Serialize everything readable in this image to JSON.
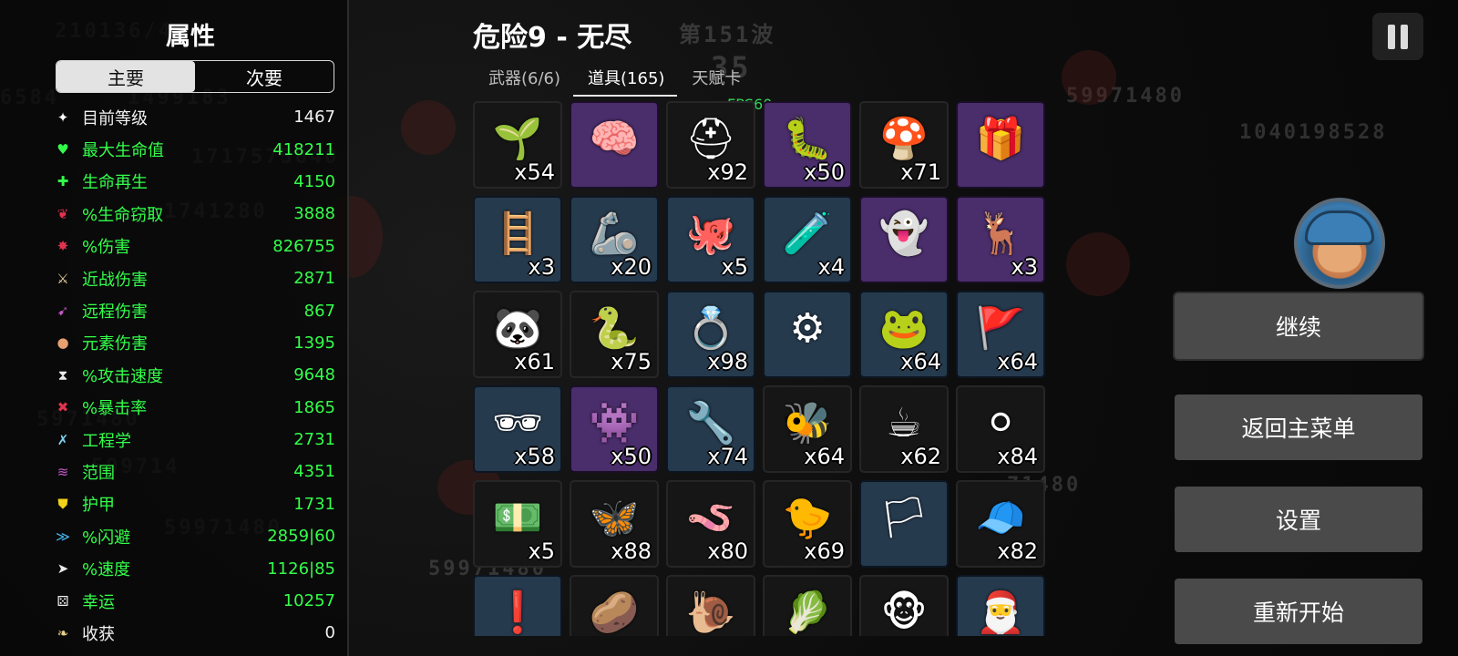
{
  "stats_panel": {
    "title": "属性",
    "tabs": {
      "primary": "主要",
      "secondary": "次要"
    },
    "stats": [
      {
        "icon": "level-icon",
        "glyph": "✦",
        "label": "目前等级",
        "value": "1467",
        "style": "normal",
        "icon_color": "#ffffff"
      },
      {
        "icon": "heart-icon",
        "glyph": "♥",
        "label": "最大生命值",
        "value": "418211",
        "style": "green",
        "icon_color": "#33ff4a"
      },
      {
        "icon": "regen-icon",
        "glyph": "✚",
        "label": "生命再生",
        "value": "4150",
        "style": "green",
        "icon_color": "#33ff4a"
      },
      {
        "icon": "lifesteal-icon",
        "glyph": "❦",
        "label": "%生命窃取",
        "value": "3888",
        "style": "green",
        "icon_color": "#e0334f"
      },
      {
        "icon": "damage-icon",
        "glyph": "✸",
        "label": "%伤害",
        "value": "826755",
        "style": "green",
        "icon_color": "#e0334f"
      },
      {
        "icon": "melee-icon",
        "glyph": "⚔",
        "label": "近战伤害",
        "value": "2871",
        "style": "green",
        "icon_color": "#f0d8a0"
      },
      {
        "icon": "ranged-icon",
        "glyph": "➹",
        "label": "远程伤害",
        "value": "867",
        "style": "green",
        "icon_color": "#c058c8"
      },
      {
        "icon": "elemental-icon",
        "glyph": "●",
        "label": "元素伤害",
        "value": "1395",
        "style": "green",
        "icon_color": "#e8a070"
      },
      {
        "icon": "attack-speed-icon",
        "glyph": "⧗",
        "label": "%攻击速度",
        "value": "9648",
        "style": "green",
        "icon_color": "#eaeaea"
      },
      {
        "icon": "crit-icon",
        "glyph": "✖",
        "label": "%暴击率",
        "value": "1865",
        "style": "green",
        "icon_color": "#e0334f"
      },
      {
        "icon": "engineering-icon",
        "glyph": "✗",
        "label": "工程学",
        "value": "2731",
        "style": "green",
        "icon_color": "#7fd0f0"
      },
      {
        "icon": "range-icon",
        "glyph": "≋",
        "label": "范围",
        "value": "4351",
        "style": "green",
        "icon_color": "#c058c8"
      },
      {
        "icon": "armor-icon",
        "glyph": "⛊",
        "label": "护甲",
        "value": "1731",
        "style": "green",
        "icon_color": "#f2d21a"
      },
      {
        "icon": "dodge-icon",
        "glyph": "≫",
        "label": "%闪避",
        "value": "2859|60",
        "style": "green",
        "icon_color": "#4ab8f0"
      },
      {
        "icon": "speed-icon",
        "glyph": "➤",
        "label": "%速度",
        "value": "1126|85",
        "style": "green",
        "icon_color": "#eaeaea"
      },
      {
        "icon": "luck-icon",
        "glyph": "⚄",
        "label": "幸运",
        "value": "10257",
        "style": "green",
        "icon_color": "#eaeaea"
      },
      {
        "icon": "harvest-icon",
        "glyph": "❧",
        "label": "收获",
        "value": "0",
        "style": "normal",
        "icon_color": "#e8d08a"
      }
    ]
  },
  "header": {
    "title": "危险9 - 无尽",
    "tabs": [
      {
        "label": "武器(6/6)",
        "active": false
      },
      {
        "label": "道具(165)",
        "active": true
      },
      {
        "label": "天赋卡",
        "active": false
      }
    ],
    "fps": "FPS60"
  },
  "background": {
    "floating_numbers": [
      "210136/4",
      "6584",
      "1499183",
      "1717575040",
      "1741280",
      "59971480",
      "1040198528",
      "5971480",
      "599714",
      "59971480",
      "59971480",
      "71480",
      "第151波",
      "35"
    ]
  },
  "items": [
    {
      "name": "sprout-item-icon",
      "glyph": "🌱",
      "count": "x54",
      "tier": "dark"
    },
    {
      "name": "brain-item-icon",
      "glyph": "🧠",
      "count": "",
      "tier": "purple"
    },
    {
      "name": "helmet-item-icon",
      "glyph": "⛑",
      "count": "x92",
      "tier": "dark"
    },
    {
      "name": "tardigrade-item-icon",
      "glyph": "🐛",
      "count": "x50",
      "tier": "purple"
    },
    {
      "name": "mushroom-item-icon",
      "glyph": "🍄",
      "count": "x71",
      "tier": "dark"
    },
    {
      "name": "gift-box-item-icon",
      "glyph": "🎁",
      "count": "",
      "tier": "purple"
    },
    {
      "name": "slime-ladder-item-icon",
      "glyph": "🪜",
      "count": "x3",
      "tier": "blue"
    },
    {
      "name": "robot-arm-item-icon",
      "glyph": "🦾",
      "count": "x20",
      "tier": "blue"
    },
    {
      "name": "tentacle-item-icon",
      "glyph": "🐙",
      "count": "x5",
      "tier": "blue"
    },
    {
      "name": "potion-bottle-item-icon",
      "glyph": "🧪",
      "count": "x4",
      "tier": "blue"
    },
    {
      "name": "white-ghost-item-icon",
      "glyph": "👻",
      "count": "",
      "tier": "purple"
    },
    {
      "name": "antlered-beast-item-icon",
      "glyph": "🦌",
      "count": "x3",
      "tier": "purple"
    },
    {
      "name": "panda-mask-item-icon",
      "glyph": "🐼",
      "count": "x61",
      "tier": "dark"
    },
    {
      "name": "green-snake-item-icon",
      "glyph": "🐍",
      "count": "x75",
      "tier": "dark"
    },
    {
      "name": "ring-item-icon",
      "glyph": "💍",
      "count": "x98",
      "tier": "blue"
    },
    {
      "name": "turret-item-icon",
      "glyph": "⚙",
      "count": "",
      "tier": "blue"
    },
    {
      "name": "frog-item-icon",
      "glyph": "🐸",
      "count": "x64",
      "tier": "blue"
    },
    {
      "name": "red-flag-item-icon",
      "glyph": "🚩",
      "count": "x64",
      "tier": "blue"
    },
    {
      "name": "goggles-item-icon",
      "glyph": "🕶",
      "count": "x58",
      "tier": "blue"
    },
    {
      "name": "monster-ring-item-icon",
      "glyph": "👾",
      "count": "x50",
      "tier": "purple"
    },
    {
      "name": "hook-item-icon",
      "glyph": "🔧",
      "count": "x74",
      "tier": "blue"
    },
    {
      "name": "bee-item-icon",
      "glyph": "🐝",
      "count": "x64",
      "tier": "dark"
    },
    {
      "name": "cup-item-icon",
      "glyph": "☕",
      "count": "x62",
      "tier": "dark"
    },
    {
      "name": "snowball-item-icon",
      "glyph": "⚪",
      "count": "x84",
      "tier": "dark"
    },
    {
      "name": "banknote-item-icon",
      "glyph": "💵",
      "count": "x5",
      "tier": "dark"
    },
    {
      "name": "butterfly-item-icon",
      "glyph": "🦋",
      "count": "x88",
      "tier": "dark"
    },
    {
      "name": "red-worm-item-icon",
      "glyph": "🪱",
      "count": "x80",
      "tier": "dark"
    },
    {
      "name": "rubber-duck-item-icon",
      "glyph": "🐤",
      "count": "x69",
      "tier": "dark"
    },
    {
      "name": "white-flag-item-icon",
      "glyph": "🏳",
      "count": "",
      "tier": "blue"
    },
    {
      "name": "propeller-cap-item-icon",
      "glyph": "🧢",
      "count": "x82",
      "tier": "dark"
    },
    {
      "name": "alert-creature-item-icon",
      "glyph": "❗",
      "count": "",
      "tier": "blue"
    },
    {
      "name": "root-item-icon",
      "glyph": "🥔",
      "count": "",
      "tier": "dark"
    },
    {
      "name": "snail-item-icon",
      "glyph": "🐌",
      "count": "",
      "tier": "dark"
    },
    {
      "name": "cabbage-item-icon",
      "glyph": "🥬",
      "count": "",
      "tier": "dark"
    },
    {
      "name": "monkey-item-icon",
      "glyph": "🐵",
      "count": "",
      "tier": "dark"
    },
    {
      "name": "red-hood-item-icon",
      "glyph": "🎅",
      "count": "",
      "tier": "blue"
    }
  ],
  "menu": {
    "continue": "继续",
    "main_menu": "返回主菜单",
    "settings": "设置",
    "restart": "重新开始"
  }
}
